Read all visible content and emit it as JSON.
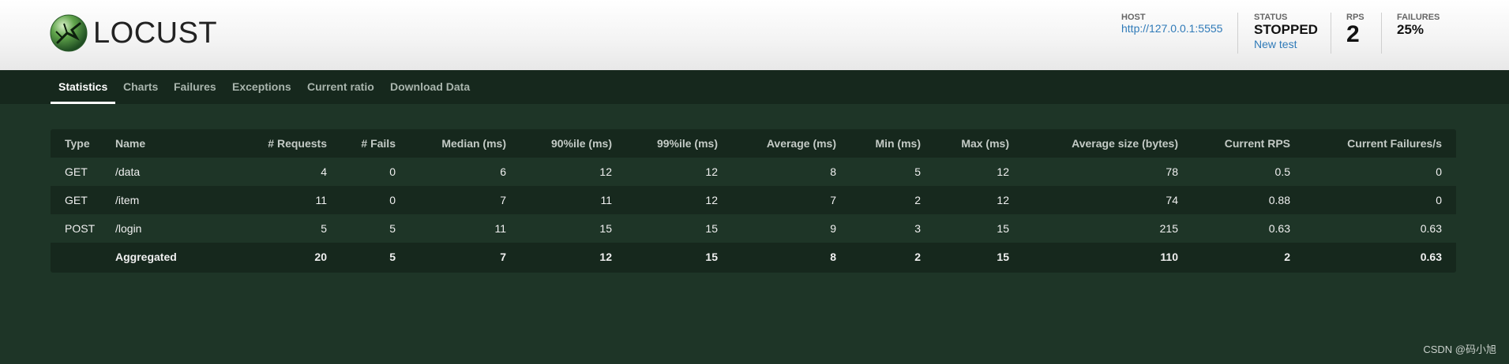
{
  "header": {
    "logo_text": "LOCUST",
    "host": {
      "label": "HOST",
      "value": "http://127.0.0.1:5555"
    },
    "status": {
      "label": "STATUS",
      "value": "STOPPED",
      "link": "New test"
    },
    "rps": {
      "label": "RPS",
      "value": "2"
    },
    "failures": {
      "label": "FAILURES",
      "value": "25%"
    }
  },
  "nav": {
    "tabs": [
      {
        "label": "Statistics",
        "active": true
      },
      {
        "label": "Charts"
      },
      {
        "label": "Failures"
      },
      {
        "label": "Exceptions"
      },
      {
        "label": "Current ratio"
      },
      {
        "label": "Download Data"
      }
    ]
  },
  "stats_table": {
    "headers": [
      "Type",
      "Name",
      "# Requests",
      "# Fails",
      "Median (ms)",
      "90%ile (ms)",
      "99%ile (ms)",
      "Average (ms)",
      "Min (ms)",
      "Max (ms)",
      "Average size (bytes)",
      "Current RPS",
      "Current Failures/s"
    ],
    "rows": [
      [
        "GET",
        "/data",
        "4",
        "0",
        "6",
        "12",
        "12",
        "8",
        "5",
        "12",
        "78",
        "0.5",
        "0"
      ],
      [
        "GET",
        "/item",
        "11",
        "0",
        "7",
        "11",
        "12",
        "7",
        "2",
        "12",
        "74",
        "0.88",
        "0"
      ],
      [
        "POST",
        "/login",
        "5",
        "5",
        "11",
        "15",
        "15",
        "9",
        "3",
        "15",
        "215",
        "0.63",
        "0.63"
      ]
    ],
    "aggregated": [
      "",
      "Aggregated",
      "20",
      "5",
      "7",
      "12",
      "15",
      "8",
      "2",
      "15",
      "110",
      "2",
      "0.63"
    ]
  },
  "watermark": "CSDN @码小旭",
  "colors": {
    "background": "#1e3527",
    "nav_background": "#16281d",
    "link": "#2f7ab8"
  }
}
